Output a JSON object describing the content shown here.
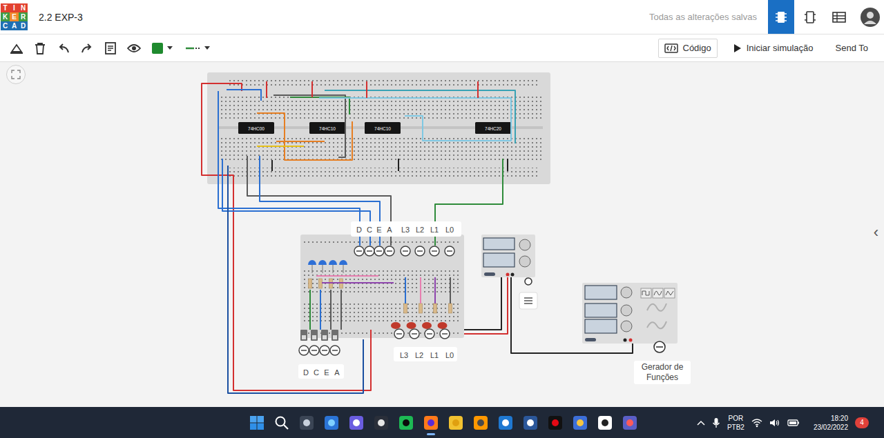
{
  "app": {
    "logo": [
      "T",
      "I",
      "N",
      "K",
      "E",
      "R",
      "C",
      "A",
      "D"
    ],
    "title": "2.2 EXP-3",
    "save_status": "Todas as alterações salvas"
  },
  "view_buttons": [
    {
      "selected": true
    },
    {
      "selected": false
    },
    {
      "selected": false
    }
  ],
  "toolbar": {
    "wire_color": "#1f8a2e",
    "buttons": [
      {
        "label": "Código"
      },
      {
        "label": "Iniciar simulação"
      },
      {
        "label": "Send To"
      }
    ]
  },
  "breadboard": {
    "chips": [
      {
        "label": "74HC00"
      },
      {
        "label": "74HC10"
      },
      {
        "label": "74HC10"
      },
      {
        "label": "74HC20"
      }
    ]
  },
  "probes": [
    {
      "label": "D"
    },
    {
      "label": "C"
    },
    {
      "label": "E"
    },
    {
      "label": "A"
    },
    {
      "label": "L3"
    },
    {
      "label": "L2"
    },
    {
      "label": "L1"
    },
    {
      "label": "L0"
    }
  ],
  "switches": [
    {
      "label": "D",
      "on": false
    },
    {
      "label": "C",
      "on": false
    },
    {
      "label": "E",
      "on": false
    },
    {
      "label": "A",
      "on": false
    }
  ],
  "leds": [
    {
      "label": "L3",
      "lit": false
    },
    {
      "label": "L2",
      "lit": false
    },
    {
      "label": "L1",
      "lit": false
    },
    {
      "label": "L0",
      "lit": false
    }
  ],
  "function_generator": {
    "label": "Gerador de Funções"
  },
  "side_toggle": "‹",
  "wires": [
    {
      "color": "#d32f2f"
    },
    {
      "color": "#2a6fd1"
    },
    {
      "color": "#2a6fd1"
    },
    {
      "color": "#d32f2f"
    },
    {
      "color": "#5a5a5a"
    },
    {
      "color": "#e67e22"
    },
    {
      "color": "#2e8b3a"
    },
    {
      "color": "#d32f2f"
    },
    {
      "color": "#3aa3b5"
    },
    {
      "color": "#7ec8e3"
    },
    {
      "color": "#d32f2f"
    },
    {
      "color": "#d32f2f"
    },
    {
      "color": "#5a5a5a"
    },
    {
      "color": "#2a6fd1"
    },
    {
      "color": "#2a6fd1"
    },
    {
      "color": "#2e8b3a"
    },
    {
      "color": "#222222"
    },
    {
      "color": "#222222"
    },
    {
      "color": "#222222"
    },
    {
      "color": "#e8c21a"
    },
    {
      "color": "#1a4fa0"
    },
    {
      "color": "#e77fb0"
    },
    {
      "color": "#8e44ad"
    },
    {
      "color": "#d32f2f"
    },
    {
      "color": "#222222"
    },
    {
      "color": "#222222"
    },
    {
      "color": "#2e8b3a"
    },
    {
      "color": "#2a6fd1"
    },
    {
      "color": "#5a5a5a"
    },
    {
      "color": "#5a5a5a"
    },
    {
      "color": "#2a6fd1"
    },
    {
      "color": "#e77fb0"
    },
    {
      "color": "#8e44ad"
    },
    {
      "color": "#5a5a5a"
    },
    {
      "color": "#e67e22"
    }
  ],
  "taskbar": {
    "apps": [
      {
        "active": false
      },
      {
        "active": false
      },
      {
        "active": false
      },
      {
        "active": false
      },
      {
        "active": false
      },
      {
        "active": false
      },
      {
        "active": false
      },
      {
        "active": true
      },
      {
        "active": false
      },
      {
        "active": false
      },
      {
        "active": false
      },
      {
        "active": false
      },
      {
        "active": false
      },
      {
        "active": false
      },
      {
        "active": false
      },
      {
        "active": false
      }
    ],
    "language": "POR",
    "layout": "PTB2",
    "time": "18:20",
    "date": "23/02/2022",
    "notifications": "4"
  }
}
